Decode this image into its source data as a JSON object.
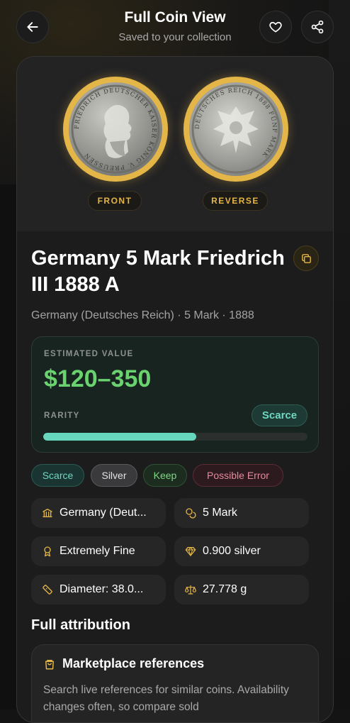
{
  "header": {
    "title": "Full Coin View",
    "subtitle": "Saved to your collection",
    "back_icon": "arrow-left-icon",
    "favorite_icon": "heart-icon",
    "share_icon": "share-icon"
  },
  "images": {
    "front_label": "FRONT",
    "reverse_label": "REVERSE",
    "front_legend": "FRIEDRICH DEUTSCHER KAISER KÖNIG V. PREUSSEN",
    "reverse_legend": "DEUTSCHES REICH 1888 FÜNF MARK"
  },
  "coin": {
    "name": "Germany 5 Mark Friedrich III 1888 A",
    "subtitle": "Germany (Deutsches Reich) · 5 Mark · 1888"
  },
  "value": {
    "estimated_label": "ESTIMATED VALUE",
    "estimated": "$120–350",
    "rarity_label": "RARITY",
    "rarity_badge": "Scarce",
    "rarity_level": 0.58
  },
  "tags": [
    "Scarce",
    "Silver",
    "Keep",
    "Possible Error"
  ],
  "details": [
    {
      "icon": "bank-icon",
      "text": "Germany (Deut..."
    },
    {
      "icon": "coins-icon",
      "text": "5 Mark"
    },
    {
      "icon": "award-icon",
      "text": "Extremely Fine"
    },
    {
      "icon": "diamond-icon",
      "text": "0.900 silver"
    },
    {
      "icon": "ruler-icon",
      "text": "Diameter: 38.0..."
    },
    {
      "icon": "scale-icon",
      "text": "27.778 g"
    }
  ],
  "attribution": {
    "title": "Full attribution",
    "market_title": "Marketplace references",
    "market_text": "Search live references for similar coins. Availability changes often, so compare sold"
  },
  "colors": {
    "accent_gold": "#e4b547",
    "value_green": "#6ad26f",
    "rarity_teal": "#66d6bc",
    "error_pink": "#e58a9c"
  }
}
